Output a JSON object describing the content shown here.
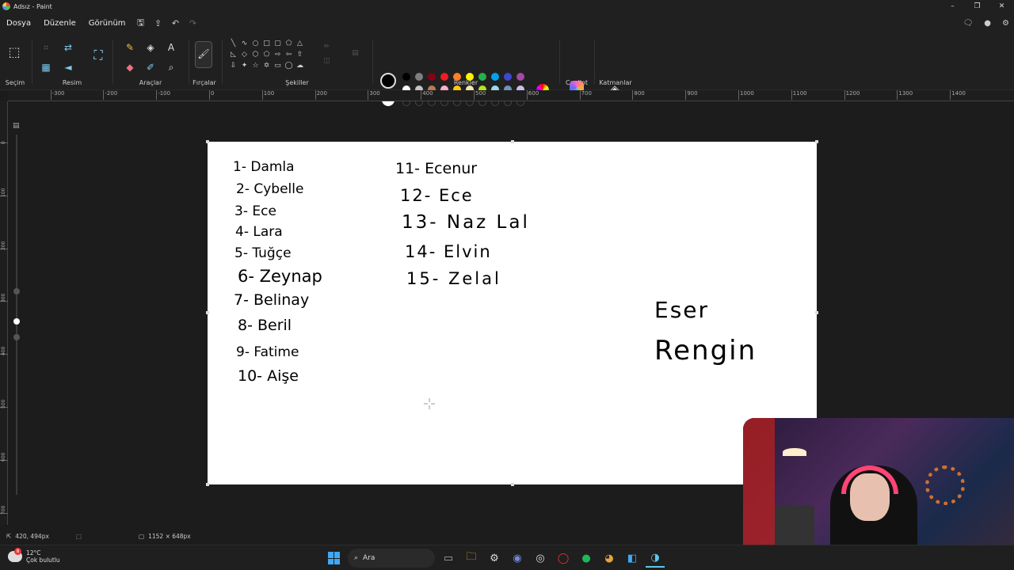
{
  "window": {
    "title": "Adsız - Paint",
    "controls": [
      "–",
      "❐",
      "✕"
    ]
  },
  "menu": {
    "file": "Dosya",
    "edit": "Düzenle",
    "view": "Görünüm"
  },
  "ribbon": {
    "selection": "Seçim",
    "image": "Resim",
    "tools": "Araçlar",
    "brushes": "Fırçalar",
    "shapes": "Şekiller",
    "colors": "Renkler",
    "copilot": "Copilot",
    "layers": "Katmanlar"
  },
  "palette": {
    "primary": "#000000",
    "secondary": "#ffffff",
    "row1": [
      "#000000",
      "#7f7f7f",
      "#880015",
      "#ed1c24",
      "#ff7f27",
      "#fff200",
      "#22b14c",
      "#00a2e8",
      "#3f48cc",
      "#a349a4"
    ],
    "row2": [
      "#ffffff",
      "#c3c3c3",
      "#b97a57",
      "#ffaec9",
      "#ffc90e",
      "#efe4b0",
      "#b5e61d",
      "#99d9ea",
      "#7092be",
      "#c8bfe7"
    ]
  },
  "ruler": {
    "h": [
      "-300",
      "-200",
      "-100",
      "0",
      "100",
      "200",
      "300",
      "400",
      "500",
      "600",
      "700",
      "800",
      "900",
      "1000",
      "1100",
      "1200",
      "1300",
      "1400"
    ],
    "v": [
      "0",
      "100",
      "200",
      "300",
      "400",
      "500",
      "600",
      "700"
    ]
  },
  "canvas": {
    "list_left": [
      "1- Damla",
      "2- Cybelle",
      "3- Ece",
      "4- Lara",
      "5- Tuğçe",
      "6- Zeynap",
      "7- Belinay",
      "8- Beril",
      "9- Fatime",
      "10- Aişe"
    ],
    "list_right": [
      "11- Ecenur",
      "12- Ece",
      "13- Naz Lal",
      "14- Elvin",
      "15- Zelal"
    ],
    "side": [
      "Eser",
      "Rengin"
    ]
  },
  "status": {
    "cursor_pos": "420, 494px",
    "canvas_size": "1152 × 648px"
  },
  "taskbar": {
    "weather_temp": "12°C",
    "weather_desc": "Çok bulutlu",
    "weather_badge": "8",
    "search_placeholder": "Ara"
  }
}
